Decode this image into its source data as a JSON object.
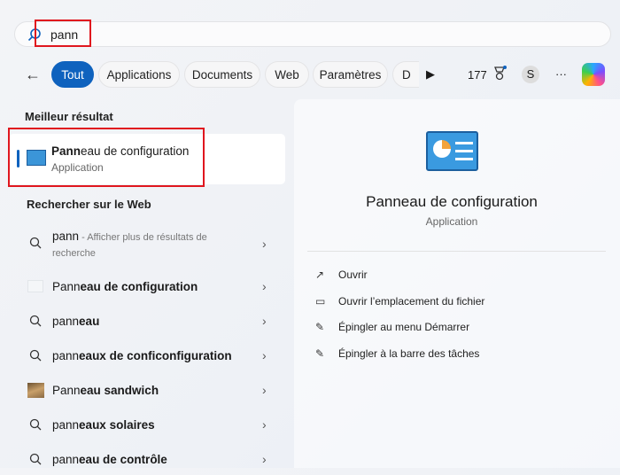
{
  "search": {
    "value": "pann"
  },
  "filters": {
    "tabs": [
      "Tout",
      "Applications",
      "Documents",
      "Web",
      "Paramètres",
      "D"
    ],
    "count": "177",
    "avatar": "S",
    "more": "···"
  },
  "best": {
    "heading": "Meilleur résultat",
    "title_match": "Pann",
    "title_rest": "eau de configuration",
    "subtitle": "Application"
  },
  "web": {
    "heading": "Rechercher sur le Web",
    "first": {
      "match": "pann",
      "rest": " - Afficher plus de résultats de recherche"
    },
    "items": [
      {
        "icon": "control-panel-thumb-icon",
        "match": "Pann",
        "rest": "eau de configuration"
      },
      {
        "icon": "search-icon",
        "match": "pann",
        "rest": "eau"
      },
      {
        "icon": "search-icon",
        "match": "pann",
        "rest": "eaux de conficonfiguration"
      },
      {
        "icon": "sandwich-panel-thumb-icon",
        "match": "Pann",
        "rest": "eau sandwich"
      },
      {
        "icon": "search-icon",
        "match": "pann",
        "rest": "eaux solaires"
      },
      {
        "icon": "search-icon",
        "match": "pann",
        "rest": "eau de contrôle"
      }
    ]
  },
  "detail": {
    "title": "Panneau de configuration",
    "subtitle": "Application",
    "actions": [
      {
        "icon": "open-icon",
        "label": "Ouvrir"
      },
      {
        "icon": "folder-icon",
        "label": "Ouvrir l’emplacement du fichier"
      },
      {
        "icon": "pin-icon",
        "label": "Épingler au menu Démarrer"
      },
      {
        "icon": "pin-icon",
        "label": "Épingler à la barre des tâches"
      }
    ]
  },
  "colors": {
    "accent": "#0f62be",
    "highlight": "#e0161e"
  }
}
